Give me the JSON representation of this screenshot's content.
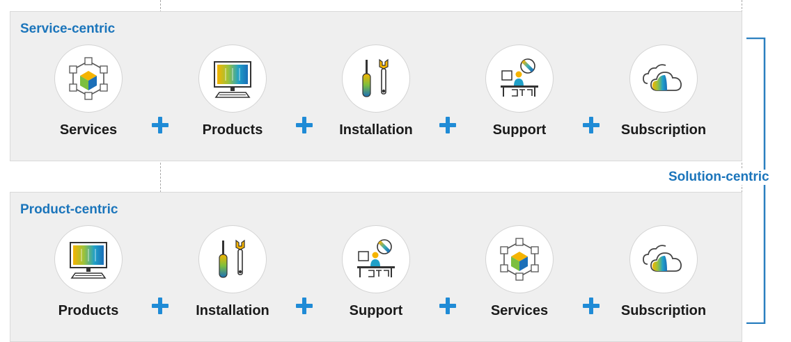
{
  "service_centric": {
    "title": "Service-centric",
    "items": [
      {
        "label": "Services",
        "icon": "services-cube-icon"
      },
      {
        "label": "Products",
        "icon": "monitor-icon"
      },
      {
        "label": "Installation",
        "icon": "tools-icon"
      },
      {
        "label": "Support",
        "icon": "support-desk-icon"
      },
      {
        "label": "Subscription",
        "icon": "cloud-icon"
      }
    ]
  },
  "product_centric": {
    "title": "Product-centric",
    "items": [
      {
        "label": "Products",
        "icon": "monitor-icon"
      },
      {
        "label": "Installation",
        "icon": "tools-icon"
      },
      {
        "label": "Support",
        "icon": "support-desk-icon"
      },
      {
        "label": "Services",
        "icon": "services-cube-icon"
      },
      {
        "label": "Subscription",
        "icon": "cloud-icon"
      }
    ]
  },
  "solution_centric": {
    "label": "Solution-centric"
  },
  "colors": {
    "accent_blue": "#1b75bb",
    "plus_blue": "#1f8bd6",
    "bracket_blue": "#2a7fbf",
    "gradient": [
      "#f5b400",
      "#7cbf3f",
      "#1fa0c8",
      "#1b6fb8"
    ]
  }
}
